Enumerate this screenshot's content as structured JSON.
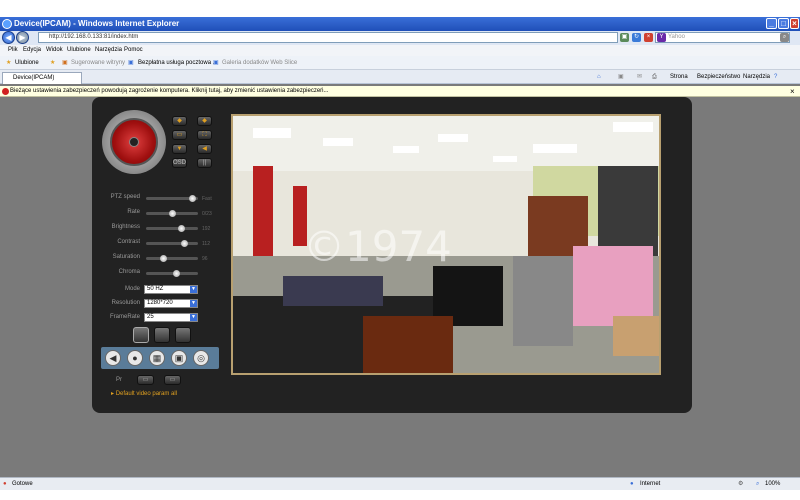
{
  "window": {
    "title": "Device(IPCAM) - Windows Internet Explorer",
    "address": "http://192.168.0.133:81/index.htm",
    "search_placeholder": "Yahoo",
    "controls": {
      "minimize": "_",
      "maximize": "□",
      "close": "×"
    }
  },
  "menu": [
    "Plik",
    "Edycja",
    "Widok",
    "Ulubione",
    "Narzędzia",
    "Pomoc"
  ],
  "favorites": {
    "label": "Ulubione",
    "items": [
      "Sugerowane witryny",
      "Bezpłatna usługa pocztowa ...",
      "Galeria dodatków Web Slice"
    ]
  },
  "tab": {
    "label": "Device(IPCAM)"
  },
  "commands": [
    "Strona",
    "Bezpieczeństwo",
    "Narzędzia"
  ],
  "infobar": {
    "text": "Bieżące ustawienia zabezpieczeń powodują zagrożenie komputera. Kliknij tutaj, aby zmienić ustawienia zabezpieczeń..."
  },
  "camera": {
    "ptz_buttons": [
      "OSD",
      "||"
    ],
    "sliders": [
      {
        "label": "PTZ speed",
        "value": "Fast",
        "level": 0.95
      },
      {
        "label": "Rate",
        "value": "0/23",
        "level": 0.5
      },
      {
        "label": "Brightness",
        "value": "192",
        "level": 0.72
      },
      {
        "label": "Contrast",
        "value": "112",
        "level": 0.78
      },
      {
        "label": "Saturation",
        "value": "96",
        "level": 0.32
      },
      {
        "label": "Chroma",
        "value": "",
        "level": 0.6
      }
    ],
    "selects": [
      {
        "label": "Mode",
        "value": "50 HZ"
      },
      {
        "label": "Resolution",
        "value": "1280*720"
      },
      {
        "label": "FrameRate",
        "value": "25"
      }
    ],
    "preset_label": "Pr",
    "default_link": "Default video param all",
    "watermark": "©1974"
  },
  "status": {
    "left": "Gotowe",
    "zone": "Internet",
    "zoom": "100%"
  },
  "colors": {
    "accent": "#e0a020",
    "panel": "#222222",
    "joystick": "#c02020"
  }
}
